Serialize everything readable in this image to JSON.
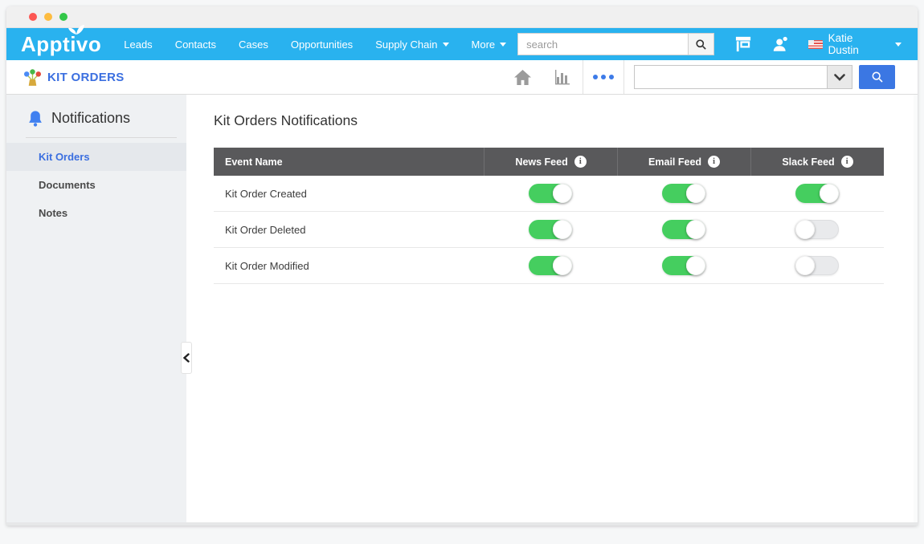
{
  "colors": {
    "navbar_blue": "#29b2ef",
    "app_title_blue": "#3b6fe0",
    "search_button_blue": "#3b77e3",
    "toggle_on_green": "#45ce5f",
    "table_header_gray": "#59595b"
  },
  "navbar": {
    "brand": "Apptivo",
    "items": [
      "Leads",
      "Contacts",
      "Cases",
      "Opportunities",
      "Supply Chain",
      "More"
    ],
    "search_placeholder": "search",
    "user_name": "Katie Dustin"
  },
  "appbar": {
    "app_title": "KIT ORDERS",
    "search_value": ""
  },
  "sidebar": {
    "header": "Notifications",
    "items": [
      {
        "label": "Kit Orders",
        "active": true
      },
      {
        "label": "Documents",
        "active": false
      },
      {
        "label": "Notes",
        "active": false
      }
    ]
  },
  "main": {
    "title": "Kit Orders Notifications",
    "table": {
      "columns": [
        "Event Name",
        "News Feed",
        "Email Feed",
        "Slack Feed"
      ],
      "info_glyph": "i",
      "rows": [
        {
          "event": "Kit Order Created",
          "news_feed": "on",
          "email_feed": "on",
          "slack_feed": "on"
        },
        {
          "event": "Kit Order Deleted",
          "news_feed": "on",
          "email_feed": "on",
          "slack_feed": "off"
        },
        {
          "event": "Kit Order Modified",
          "news_feed": "on",
          "email_feed": "on",
          "slack_feed": "off"
        }
      ]
    }
  }
}
